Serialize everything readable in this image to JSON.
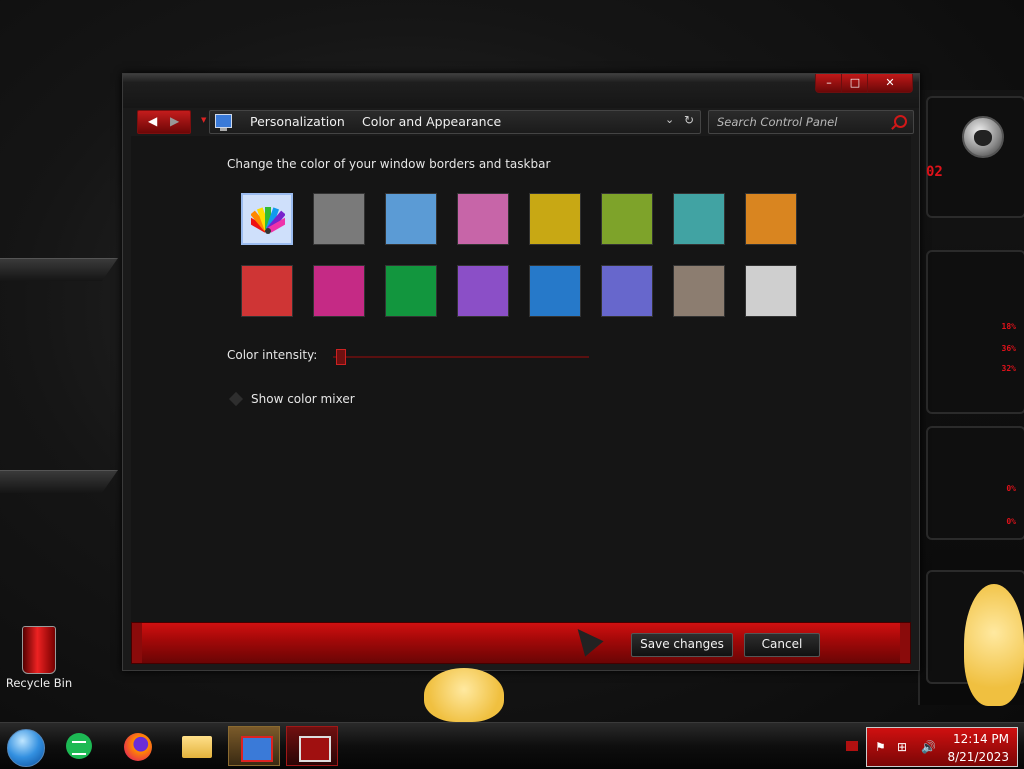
{
  "window": {
    "breadcrumb": [
      "Personalization",
      "Color and Appearance"
    ],
    "search_placeholder": "Search Control Panel",
    "heading": "Change the color of your window borders and taskbar",
    "swatches_row1": [
      {
        "name": "automatic",
        "color": "#cfe0fb",
        "selected": true
      },
      {
        "name": "slate",
        "color": "#7a7a7a"
      },
      {
        "name": "sky",
        "color": "#5b9bd5"
      },
      {
        "name": "pink",
        "color": "#c765a8"
      },
      {
        "name": "gold",
        "color": "#c8a814"
      },
      {
        "name": "lime",
        "color": "#7ea32a"
      },
      {
        "name": "teal",
        "color": "#41a3a3"
      },
      {
        "name": "orange",
        "color": "#d98520"
      }
    ],
    "swatches_row2": [
      {
        "name": "red",
        "color": "#cf3535"
      },
      {
        "name": "magenta",
        "color": "#c52a85"
      },
      {
        "name": "green",
        "color": "#12963e"
      },
      {
        "name": "purple",
        "color": "#8b4fc7"
      },
      {
        "name": "blue",
        "color": "#2679c9"
      },
      {
        "name": "violet",
        "color": "#6767cc"
      },
      {
        "name": "taupe",
        "color": "#8c7d70"
      },
      {
        "name": "silver",
        "color": "#cfcfcf"
      }
    ],
    "color_intensity_label": "Color intensity:",
    "color_intensity_level": 0.02,
    "show_mixer_label": "Show color mixer",
    "save_label": "Save changes",
    "cancel_label": "Cancel"
  },
  "desktop": {
    "recycle_bin_label": "Recycle Bin",
    "hud_percents": [
      "18%",
      "36%",
      "32%",
      "0%",
      "0%"
    ]
  },
  "taskbar": {
    "time": "12:14 PM",
    "date": "8/21/2023",
    "icons": [
      "start-orb-icon",
      "notes-app-icon",
      "firefox-icon",
      "file-explorer-icon",
      "control-panel-icon",
      "personalization-icon"
    ]
  },
  "colors": {
    "accent": "#d01010",
    "window_bg": "#151515"
  }
}
